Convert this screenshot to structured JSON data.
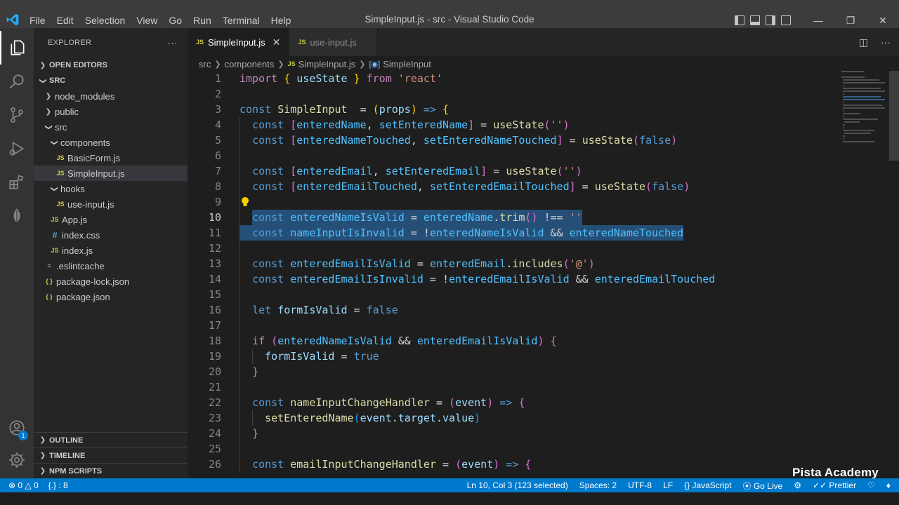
{
  "window": {
    "title": "SimpleInput.js - src - Visual Studio Code",
    "menu": [
      "File",
      "Edit",
      "Selection",
      "View",
      "Go",
      "Run",
      "Terminal",
      "Help"
    ]
  },
  "activity_bar": {
    "items": [
      "explorer-icon",
      "search-icon",
      "source-control-icon",
      "run-debug-icon",
      "extensions-icon",
      "mongodb-leaf-icon"
    ],
    "accounts_badge": "1"
  },
  "sidebar": {
    "title": "EXPLORER",
    "more": "···",
    "open_editors": "OPEN EDITORS",
    "root": "SRC",
    "tree": [
      {
        "label": "node_modules",
        "type": "folder",
        "expanded": false,
        "depth": 1
      },
      {
        "label": "public",
        "type": "folder",
        "expanded": false,
        "depth": 1
      },
      {
        "label": "src",
        "type": "folder",
        "expanded": true,
        "depth": 1
      },
      {
        "label": "components",
        "type": "folder",
        "expanded": true,
        "depth": 2
      },
      {
        "label": "BasicForm.js",
        "type": "js",
        "depth": 3
      },
      {
        "label": "SimpleInput.js",
        "type": "js",
        "depth": 3,
        "selected": true
      },
      {
        "label": "hooks",
        "type": "folder",
        "expanded": true,
        "depth": 2
      },
      {
        "label": "use-input.js",
        "type": "js",
        "depth": 3
      },
      {
        "label": "App.js",
        "type": "js",
        "depth": 2
      },
      {
        "label": "index.css",
        "type": "css",
        "depth": 2
      },
      {
        "label": "index.js",
        "type": "js",
        "depth": 2
      },
      {
        "label": ".eslintcache",
        "type": "cfg",
        "depth": 1
      },
      {
        "label": "package-lock.json",
        "type": "json",
        "depth": 1
      },
      {
        "label": "package.json",
        "type": "json",
        "depth": 1
      }
    ],
    "bottom_sections": [
      "OUTLINE",
      "TIMELINE",
      "NPM SCRIPTS"
    ]
  },
  "tabs": [
    {
      "label": "SimpleInput.js",
      "icon": "JS",
      "active": true,
      "close": "✕"
    },
    {
      "label": "use-input.js",
      "icon": "JS",
      "active": false
    }
  ],
  "breadcrumb": {
    "parts": [
      "src",
      "components",
      "SimpleInput.js",
      "SimpleInput"
    ],
    "file_icon": "JS"
  },
  "editor": {
    "current_line": 10,
    "lines": [
      {
        "n": 1,
        "indent": 0,
        "tokens": [
          [
            "kw2",
            "import "
          ],
          [
            "br1",
            "{ "
          ],
          [
            "var",
            "useState"
          ],
          [
            "br1",
            " }"
          ],
          [
            "kw2",
            " from "
          ],
          [
            "str",
            "'react'"
          ]
        ]
      },
      {
        "n": 2,
        "indent": 0,
        "tokens": []
      },
      {
        "n": 3,
        "indent": 0,
        "tokens": [
          [
            "kw",
            "const "
          ],
          [
            "fn",
            "SimpleInput"
          ],
          [
            "",
            "  = "
          ],
          [
            "br1",
            "("
          ],
          [
            "var",
            "props"
          ],
          [
            "br1",
            ")"
          ],
          [
            "kw",
            " => "
          ],
          [
            "br1",
            "{"
          ]
        ]
      },
      {
        "n": 4,
        "indent": 1,
        "tokens": [
          [
            "kw",
            "const "
          ],
          [
            "br2",
            "["
          ],
          [
            "const",
            "enteredName"
          ],
          [
            "",
            ", "
          ],
          [
            "const",
            "setEnteredName"
          ],
          [
            "br2",
            "]"
          ],
          [
            "",
            " = "
          ],
          [
            "fn",
            "useState"
          ],
          [
            "br2",
            "("
          ],
          [
            "str",
            "''"
          ],
          [
            "br2",
            ")"
          ]
        ]
      },
      {
        "n": 5,
        "indent": 1,
        "tokens": [
          [
            "kw",
            "const "
          ],
          [
            "br2",
            "["
          ],
          [
            "const",
            "enteredNameTouched"
          ],
          [
            "",
            ", "
          ],
          [
            "const",
            "setEnteredNameTouched"
          ],
          [
            "br2",
            "]"
          ],
          [
            "",
            " = "
          ],
          [
            "fn",
            "useState"
          ],
          [
            "br2",
            "("
          ],
          [
            "kw",
            "false"
          ],
          [
            "br2",
            ")"
          ]
        ]
      },
      {
        "n": 6,
        "indent": 1,
        "tokens": []
      },
      {
        "n": 7,
        "indent": 1,
        "tokens": [
          [
            "kw",
            "const "
          ],
          [
            "br2",
            "["
          ],
          [
            "const",
            "enteredEmail"
          ],
          [
            "",
            ", "
          ],
          [
            "const",
            "setEnteredEmail"
          ],
          [
            "br2",
            "]"
          ],
          [
            "",
            " = "
          ],
          [
            "fn",
            "useState"
          ],
          [
            "br2",
            "("
          ],
          [
            "str",
            "''"
          ],
          [
            "br2",
            ")"
          ]
        ]
      },
      {
        "n": 8,
        "indent": 1,
        "tokens": [
          [
            "kw",
            "const "
          ],
          [
            "br2",
            "["
          ],
          [
            "const",
            "enteredEmailTouched"
          ],
          [
            "",
            ", "
          ],
          [
            "const",
            "setEnteredEmailTouched"
          ],
          [
            "br2",
            "]"
          ],
          [
            "",
            " = "
          ],
          [
            "fn",
            "useState"
          ],
          [
            "br2",
            "("
          ],
          [
            "kw",
            "false"
          ],
          [
            "br2",
            ")"
          ]
        ]
      },
      {
        "n": 9,
        "indent": 1,
        "tokens": [],
        "lightbulb": true
      },
      {
        "n": 10,
        "indent": 1,
        "selected": true,
        "tokens": [
          [
            "kw",
            "const "
          ],
          [
            "const",
            "enteredNameIsValid"
          ],
          [
            "",
            " = "
          ],
          [
            "const",
            "enteredName"
          ],
          [
            "",
            "."
          ],
          [
            "fn",
            "trim"
          ],
          [
            "br2",
            "()"
          ],
          [
            "",
            " !== "
          ],
          [
            "str",
            "''"
          ]
        ]
      },
      {
        "n": 11,
        "indent": 1,
        "selected": true,
        "tokens": [
          [
            "kw",
            "const "
          ],
          [
            "const",
            "nameInputIsInvalid"
          ],
          [
            "",
            " = !"
          ],
          [
            "const",
            "enteredNameIsValid"
          ],
          [
            "",
            " && "
          ],
          [
            "const",
            "enteredNameTouched"
          ]
        ]
      },
      {
        "n": 12,
        "indent": 1,
        "tokens": []
      },
      {
        "n": 13,
        "indent": 1,
        "tokens": [
          [
            "kw",
            "const "
          ],
          [
            "const",
            "enteredEmailIsValid"
          ],
          [
            "",
            " = "
          ],
          [
            "const",
            "enteredEmail"
          ],
          [
            "",
            "."
          ],
          [
            "fn",
            "includes"
          ],
          [
            "br2",
            "("
          ],
          [
            "str",
            "'@'"
          ],
          [
            "br2",
            ")"
          ]
        ]
      },
      {
        "n": 14,
        "indent": 1,
        "tokens": [
          [
            "kw",
            "const "
          ],
          [
            "const",
            "enteredEmailIsInvalid"
          ],
          [
            "",
            " = !"
          ],
          [
            "const",
            "enteredEmailIsValid"
          ],
          [
            "",
            " && "
          ],
          [
            "const",
            "enteredEmailTouched"
          ]
        ]
      },
      {
        "n": 15,
        "indent": 1,
        "tokens": []
      },
      {
        "n": 16,
        "indent": 1,
        "tokens": [
          [
            "kw",
            "let "
          ],
          [
            "var",
            "formIsValid"
          ],
          [
            "",
            " = "
          ],
          [
            "kw",
            "false"
          ]
        ]
      },
      {
        "n": 17,
        "indent": 1,
        "tokens": []
      },
      {
        "n": 18,
        "indent": 1,
        "tokens": [
          [
            "kw2",
            "if "
          ],
          [
            "br2",
            "("
          ],
          [
            "const",
            "enteredNameIsValid"
          ],
          [
            "",
            " && "
          ],
          [
            "const",
            "enteredEmailIsValid"
          ],
          [
            "br2",
            ")"
          ],
          [
            "",
            " "
          ],
          [
            "br2",
            "{"
          ]
        ]
      },
      {
        "n": 19,
        "indent": 2,
        "tokens": [
          [
            "var",
            "formIsValid"
          ],
          [
            "",
            " = "
          ],
          [
            "kw",
            "true"
          ]
        ]
      },
      {
        "n": 20,
        "indent": 1,
        "tokens": [
          [
            "br2",
            "}"
          ]
        ]
      },
      {
        "n": 21,
        "indent": 1,
        "tokens": []
      },
      {
        "n": 22,
        "indent": 1,
        "tokens": [
          [
            "kw",
            "const "
          ],
          [
            "fn",
            "nameInputChangeHandler"
          ],
          [
            "",
            " = "
          ],
          [
            "br2",
            "("
          ],
          [
            "var",
            "event"
          ],
          [
            "br2",
            ")"
          ],
          [
            "kw",
            " => "
          ],
          [
            "br2",
            "{"
          ]
        ]
      },
      {
        "n": 23,
        "indent": 2,
        "tokens": [
          [
            "fn",
            "setEnteredName"
          ],
          [
            "br3",
            "("
          ],
          [
            "var",
            "event"
          ],
          [
            "",
            "."
          ],
          [
            "var",
            "target"
          ],
          [
            "",
            "."
          ],
          [
            "var",
            "value"
          ],
          [
            "br3",
            ")"
          ]
        ]
      },
      {
        "n": 24,
        "indent": 1,
        "tokens": [
          [
            "br2",
            "}"
          ]
        ]
      },
      {
        "n": 25,
        "indent": 1,
        "tokens": []
      },
      {
        "n": 26,
        "indent": 1,
        "tokens": [
          [
            "kw",
            "const "
          ],
          [
            "fn",
            "emailInputChangeHandler"
          ],
          [
            "",
            " = "
          ],
          [
            "br2",
            "("
          ],
          [
            "var",
            "event"
          ],
          [
            "br2",
            ")"
          ],
          [
            "kw",
            " => "
          ],
          [
            "br2",
            "{"
          ]
        ]
      }
    ]
  },
  "statusbar": {
    "errors": "0",
    "warnings": "0",
    "position_hint": "{.} : 8",
    "cursor": "Ln 10, Col 3 (123 selected)",
    "spaces": "Spaces: 2",
    "encoding": "UTF-8",
    "eol": "LF",
    "language": "JavaScript",
    "language_icon": "{}",
    "golive": "Go Live",
    "prettier": "Prettier"
  },
  "watermark": "Pista Academy",
  "colors": {
    "accent": "#007acc",
    "selection": "#264f78",
    "keyword": "#569cd6",
    "string": "#ce9178"
  }
}
